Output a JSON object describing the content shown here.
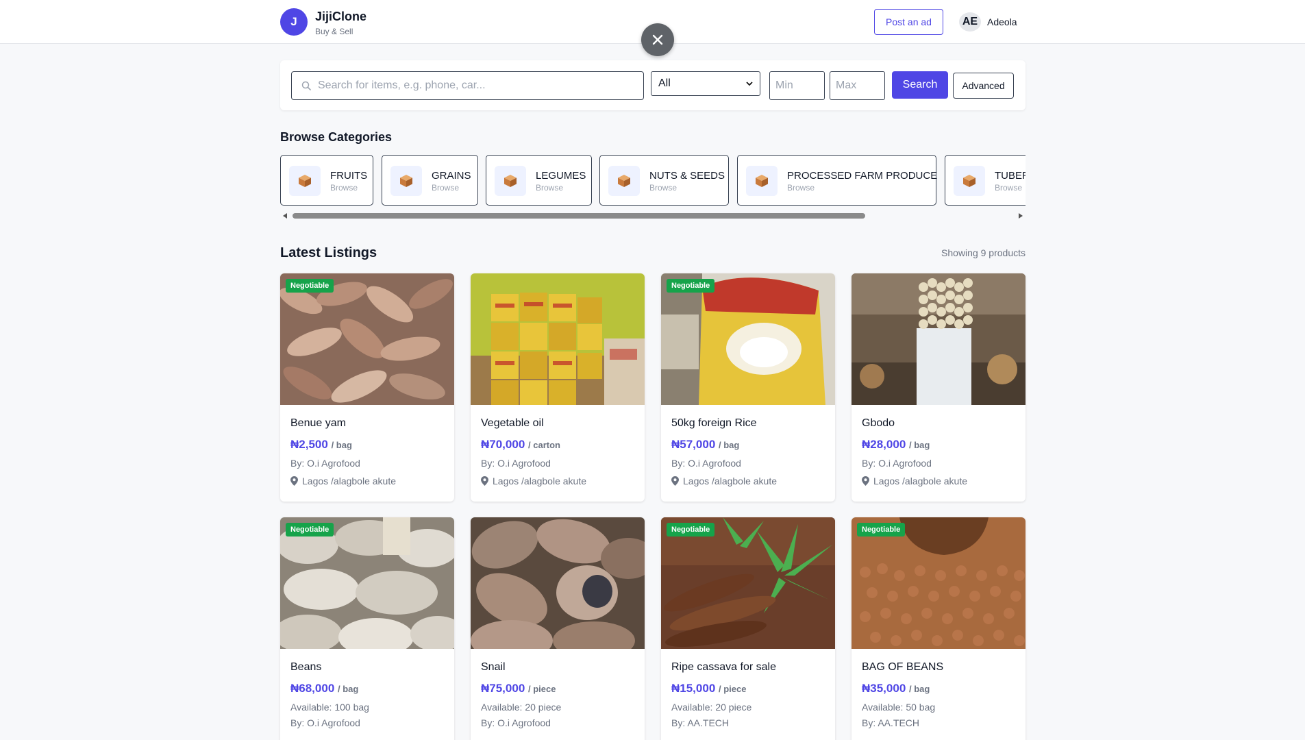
{
  "header": {
    "logo_letter": "J",
    "brand": "JijiClone",
    "tagline": "Buy & Sell",
    "post_ad": "Post an ad",
    "avatar_initials": "AE",
    "user_name": "Adeola"
  },
  "search": {
    "placeholder": "Search for items, e.g. phone, car...",
    "category_selected": "All",
    "min_placeholder": "Min",
    "max_placeholder": "Max",
    "search_label": "Search",
    "advanced_label": "Advanced"
  },
  "categories": {
    "title": "Browse Categories",
    "browse_label": "Browse",
    "items": [
      {
        "name": "FRUITS"
      },
      {
        "name": "GRAINS"
      },
      {
        "name": "LEGUMES"
      },
      {
        "name": "NUTS & SEEDS"
      },
      {
        "name": "PROCESSED FARM PRODUCE"
      },
      {
        "name": "TUBER"
      }
    ]
  },
  "listings": {
    "title": "Latest Listings",
    "count_text": "Showing 9 products",
    "badge": "Negotiable",
    "products": [
      {
        "title": "Benue yam",
        "price": "₦2,500",
        "unit": "/ bag",
        "seller": "By: O.i Agrofood",
        "location": "Lagos /alagbole akute"
      },
      {
        "title": "Vegetable oil",
        "price": "₦70,000",
        "unit": "/ carton",
        "seller": "By: O.i Agrofood",
        "location": "Lagos /alagbole akute"
      },
      {
        "title": "50kg foreign Rice",
        "price": "₦57,000",
        "unit": "/ bag",
        "seller": "By: O.i Agrofood",
        "location": "Lagos /alagbole akute"
      },
      {
        "title": "Gbodo",
        "price": "₦28,000",
        "unit": "/ bag",
        "seller": "By: O.i Agrofood",
        "location": "Lagos /alagbole akute"
      },
      {
        "title": "Beans",
        "price": "₦68,000",
        "unit": "/ bag",
        "available": "Available: 100 bag",
        "seller": "By: O.i Agrofood"
      },
      {
        "title": "Snail",
        "price": "₦75,000",
        "unit": "/ piece",
        "available": "Available: 20 piece",
        "seller": "By: O.i Agrofood"
      },
      {
        "title": "Ripe cassava for sale",
        "price": "₦15,000",
        "unit": "/ piece",
        "available": "Available: 20 piece",
        "seller": "By: AA.TECH"
      },
      {
        "title": "BAG OF BEANS",
        "price": "₦35,000",
        "unit": "/ bag",
        "available": "Available: 50 bag",
        "seller": "By: AA.TECH"
      }
    ]
  },
  "icons": {
    "close": "close-icon",
    "search": "search-icon",
    "category": "box-icon",
    "location": "location-pin-icon"
  },
  "colors": {
    "accent": "#4f46e5",
    "badge": "#16a34a"
  }
}
